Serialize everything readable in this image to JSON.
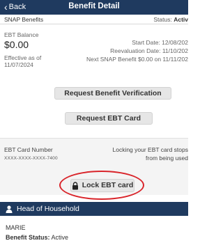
{
  "header": {
    "back_label": "Back",
    "title": "Benefit Detail"
  },
  "subheader": {
    "program": "SNAP Benefits",
    "status_label": "Status:",
    "status_value": "Activ"
  },
  "balance": {
    "label": "EBT Balance",
    "amount": "$0.00",
    "effective_line1": "Effective as of",
    "effective_line2": "11/07/2024",
    "start_date": "Start Date: 12/08/202",
    "reevaluation_date": "Reevaluation Date: 11/10/202",
    "next_benefit": "Next SNAP Benefit $0.00 on 11/11/202"
  },
  "buttons": {
    "verify": "Request Benefit Verification",
    "request_card": "Request EBT Card",
    "lock_card": "Lock EBT card"
  },
  "card": {
    "number_label": "EBT Card Number",
    "number_value": "XXXX-XXXX-XXXX-7400",
    "lock_note_line1": "Locking your EBT card stops",
    "lock_note_line2": "from being used"
  },
  "household": {
    "section_title": "Head of Household",
    "member_name": "MARIE",
    "benefit_status_label": "Benefit Status:",
    "benefit_status_value": "Active"
  },
  "colors": {
    "header_bg": "#1f3a5f",
    "highlight_ring": "#d9242a",
    "button_bg": "#e6e6e6"
  },
  "icons": {
    "back": "chevron-left-icon",
    "lock": "lock-icon",
    "person": "person-icon"
  }
}
